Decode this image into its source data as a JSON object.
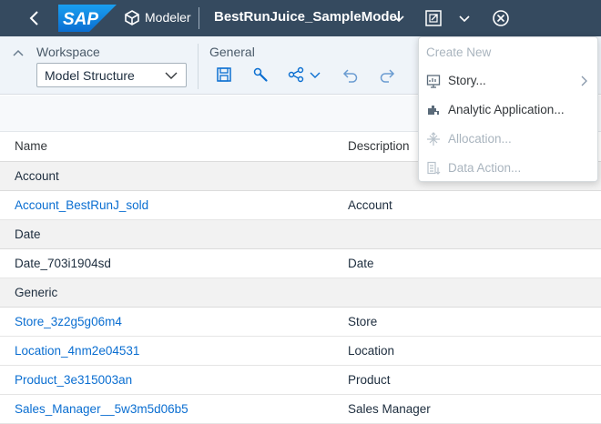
{
  "shell": {
    "logo_text": "SAP",
    "app_name": "Modeler",
    "model_title": "BestRunJuice_SampleModel",
    "icons": [
      "back-icon",
      "cube-icon",
      "chevron-down-icon",
      "open-new-icon",
      "chevron-down-icon",
      "close-circle-icon"
    ]
  },
  "toolbar": {
    "workspace_label": "Workspace",
    "workspace_value": "Model Structure",
    "general_label": "General",
    "icons": [
      "save-icon",
      "wrench-icon",
      "share-icon",
      "undo-icon",
      "redo-icon"
    ]
  },
  "table": {
    "headers": {
      "name": "Name",
      "description": "Description"
    },
    "groups": [
      {
        "label": "Account",
        "rows": [
          {
            "name": "Account_BestRunJ_sold",
            "description": "Account",
            "link": true
          }
        ]
      },
      {
        "label": "Date",
        "rows": [
          {
            "name": "Date_703i1904sd",
            "description": "Date",
            "link": false
          }
        ]
      },
      {
        "label": "Generic",
        "rows": [
          {
            "name": "Store_3z2g5g06m4",
            "description": "Store",
            "link": true
          },
          {
            "name": "Location_4nm2e04531",
            "description": "Location",
            "link": true
          },
          {
            "name": "Product_3e315003an",
            "description": "Product",
            "link": true
          },
          {
            "name": "Sales_Manager__5w3m5d06b5",
            "description": "Sales Manager",
            "link": true
          }
        ]
      }
    ]
  },
  "menu": {
    "header": "Create New",
    "items": [
      {
        "label": "Story...",
        "icon": "story-icon",
        "enabled": true,
        "submenu": true
      },
      {
        "label": "Analytic Application...",
        "icon": "analytic-application-icon",
        "enabled": true,
        "submenu": false
      },
      {
        "label": "Allocation...",
        "icon": "allocation-icon",
        "enabled": false,
        "submenu": false
      },
      {
        "label": "Data Action...",
        "icon": "data-action-icon",
        "enabled": false,
        "submenu": false
      }
    ]
  },
  "colors": {
    "shell_bg": "#354a5f",
    "sap_blue": "#0a6ed1",
    "link": "#0a6ed1",
    "toolbar_bg": "#eff4f9",
    "group_row_bg": "#f2f2f2",
    "disabled_text": "#a9b4be"
  }
}
